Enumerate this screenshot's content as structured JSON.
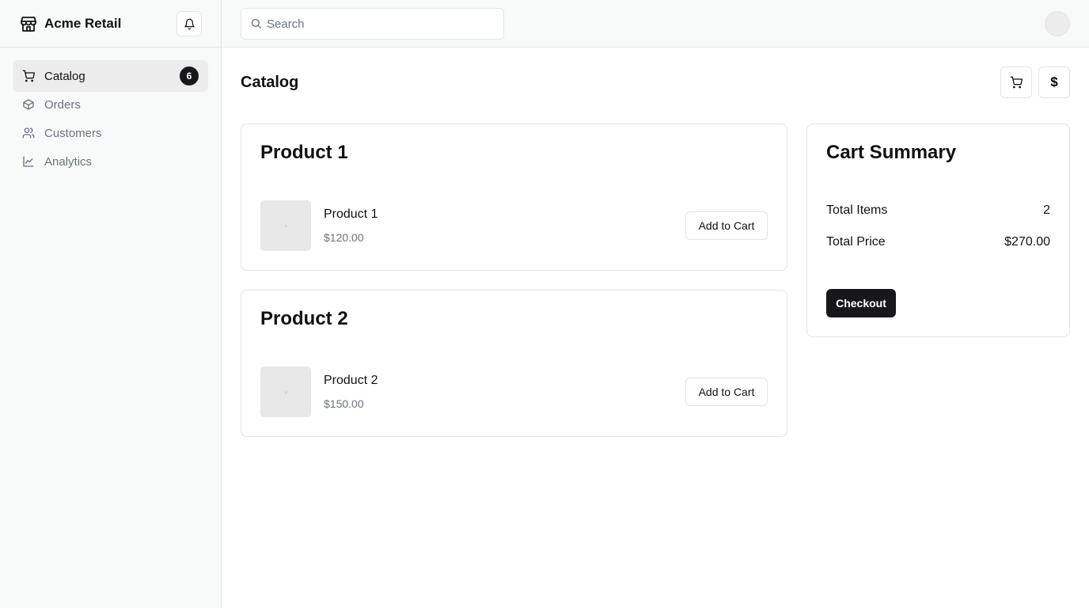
{
  "app": {
    "name": "Acme Retail"
  },
  "sidebar": {
    "items": [
      {
        "label": "Catalog",
        "icon": "cart-icon",
        "active": true,
        "badge": "6"
      },
      {
        "label": "Orders",
        "icon": "package-icon",
        "active": false
      },
      {
        "label": "Customers",
        "icon": "users-icon",
        "active": false
      },
      {
        "label": "Analytics",
        "icon": "line-chart-icon",
        "active": false
      }
    ]
  },
  "search": {
    "placeholder": "Search",
    "value": ""
  },
  "main": {
    "title": "Catalog",
    "header_buttons": {
      "cart_icon": "cart-icon",
      "currency_symbol": "$"
    },
    "products": [
      {
        "card_title": "Product 1",
        "name": "Product 1",
        "price": "$120.00",
        "button_label": "Add to Cart"
      },
      {
        "card_title": "Product 2",
        "name": "Product 2",
        "price": "$150.00",
        "button_label": "Add to Cart"
      }
    ]
  },
  "cart_summary": {
    "title": "Cart Summary",
    "total_items_label": "Total Items",
    "total_items_value": "2",
    "total_price_label": "Total Price",
    "total_price_value": "$270.00",
    "checkout_label": "Checkout"
  },
  "colors": {
    "accent": "#18181b",
    "border": "#e4e4e7",
    "muted_text": "#6b7280",
    "sidebar_bg": "#f8f9f9"
  }
}
